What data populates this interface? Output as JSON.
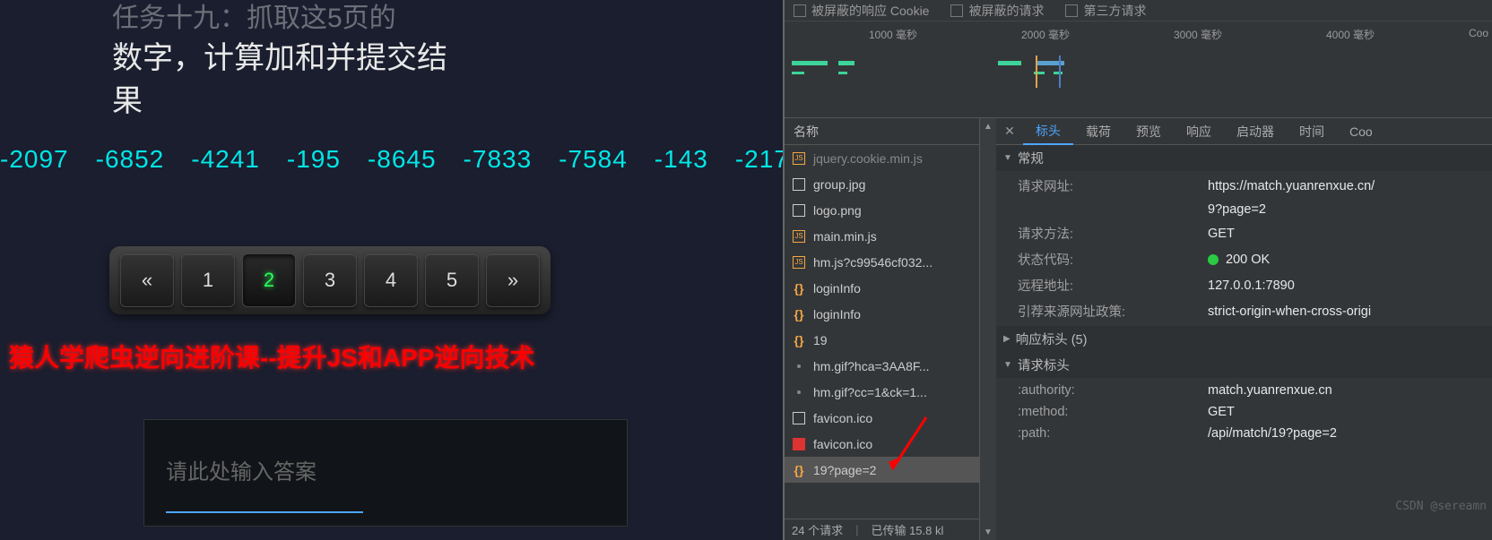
{
  "left": {
    "task_line1": "任务十九：抓取这5页的",
    "task_line2": "数字，计算加和并提交结",
    "task_line3": "果",
    "numbers": [
      "-2097",
      "-6852",
      "-4241",
      "-195",
      "-8645",
      "-7833",
      "-7584",
      "-143",
      "-217"
    ],
    "pagination": {
      "prev": "«",
      "pages": [
        "1",
        "2",
        "3",
        "4",
        "5"
      ],
      "active": "2",
      "next": "»"
    },
    "promo": "猿人学爬虫逆向进阶课--提升JS和APP逆向技术",
    "answer_label": "请此处输入答案"
  },
  "devtools": {
    "filters": {
      "blocked_cookie": "被屏蔽的响应 Cookie",
      "blocked_req": "被屏蔽的请求",
      "third_party": "第三方请求"
    },
    "timeline_ticks": [
      "1000 毫秒",
      "2000 毫秒",
      "3000 毫秒",
      "4000 毫秒"
    ],
    "timeline_extra": "Coo",
    "name_header": "名称",
    "requests": [
      {
        "name": "jquery.cookie.min.js",
        "icon": "js",
        "cut": true
      },
      {
        "name": "group.jpg",
        "icon": "img"
      },
      {
        "name": "logo.png",
        "icon": "img"
      },
      {
        "name": "main.min.js",
        "icon": "js"
      },
      {
        "name": "hm.js?c99546cf032...",
        "icon": "js"
      },
      {
        "name": "loginInfo",
        "icon": "json"
      },
      {
        "name": "loginInfo",
        "icon": "json"
      },
      {
        "name": "19",
        "icon": "json"
      },
      {
        "name": "hm.gif?hca=3AA8F...",
        "icon": "gif"
      },
      {
        "name": "hm.gif?cc=1&ck=1...",
        "icon": "gif"
      },
      {
        "name": "favicon.ico",
        "icon": "img"
      },
      {
        "name": "favicon.ico",
        "icon": "favred"
      },
      {
        "name": "19?page=2",
        "icon": "json",
        "selected": true
      }
    ],
    "summary": {
      "count": "24 个请求",
      "transferred": "已传输 15.8 kl"
    },
    "tabs": [
      "标头",
      "载荷",
      "预览",
      "响应",
      "启动器",
      "时间",
      "Coo"
    ],
    "active_tab": "标头",
    "sections": {
      "general": "常规",
      "response_headers": "响应标头 (5)",
      "request_headers": "请求标头"
    },
    "general_kv": [
      {
        "k": "请求网址:",
        "v": "https://match.yuanrenxue.cn/"
      },
      {
        "k": "",
        "v": "9?page=2"
      },
      {
        "k": "请求方法:",
        "v": "GET"
      },
      {
        "k": "状态代码:",
        "v": "200 OK",
        "status": true
      },
      {
        "k": "远程地址:",
        "v": "127.0.0.1:7890"
      },
      {
        "k": "引荐来源网址政策:",
        "v": "strict-origin-when-cross-origi"
      }
    ],
    "req_kv": [
      {
        "k": ":authority:",
        "v": "match.yuanrenxue.cn"
      },
      {
        "k": ":method:",
        "v": "GET"
      },
      {
        "k": ":path:",
        "v": "/api/match/19?page=2"
      }
    ],
    "watermark": "CSDN @sereamn"
  }
}
